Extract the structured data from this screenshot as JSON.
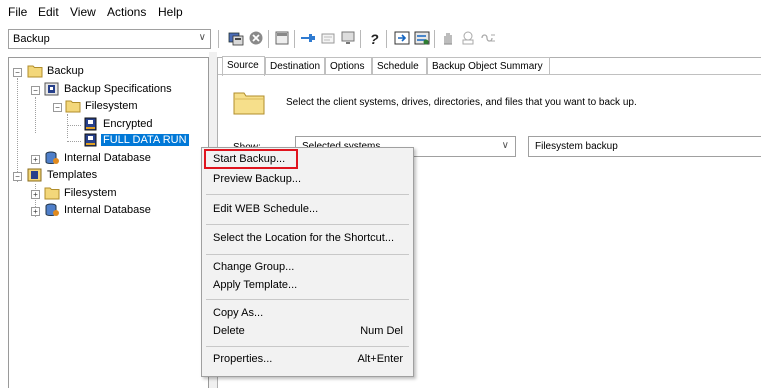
{
  "menu": [
    "File",
    "Edit",
    "View",
    "Actions",
    "Help"
  ],
  "context_combo": {
    "value": "Backup"
  },
  "toolbar_icons": [
    "backup-wizard-icon",
    "stop-icon",
    "panel-icon",
    "pin-icon",
    "results-icon",
    "monitor-icon",
    "help-icon",
    "sync-icon",
    "sync-all-icon",
    "hand-icon",
    "report-icon",
    "link-icon"
  ],
  "tree": {
    "root": "Backup",
    "backup_specifications": "Backup Specifications",
    "filesystem": "Filesystem",
    "encrypted": "Encrypted",
    "full_data_run": "FULL DATA RUN",
    "internal_database": "Internal Database",
    "templates": "Templates",
    "templates_filesystem": "Filesystem",
    "templates_internal_database": "Internal Database"
  },
  "tabs": [
    "Source",
    "Destination",
    "Options",
    "Schedule",
    "Backup Object Summary"
  ],
  "source": {
    "description": "Select the client systems, drives, directories, and files that you want to back up.",
    "show_label": "Show:",
    "show_value": "Selected systems",
    "type_value": "Filesystem backup"
  },
  "context_menu": {
    "start_backup": "Start Backup...",
    "preview_backup": "Preview Backup...",
    "edit_web_schedule": "Edit WEB Schedule...",
    "select_location": "Select the Location for the Shortcut...",
    "change_group": "Change Group...",
    "apply_template": "Apply Template...",
    "copy_as": "Copy As...",
    "delete": "Delete",
    "delete_shortcut": "Num Del",
    "properties": "Properties...",
    "properties_shortcut": "Alt+Enter"
  },
  "colors": {
    "selection": "#0078d7",
    "highlight_box": "#e0141e",
    "menu_bg": "#f2f2f2"
  }
}
